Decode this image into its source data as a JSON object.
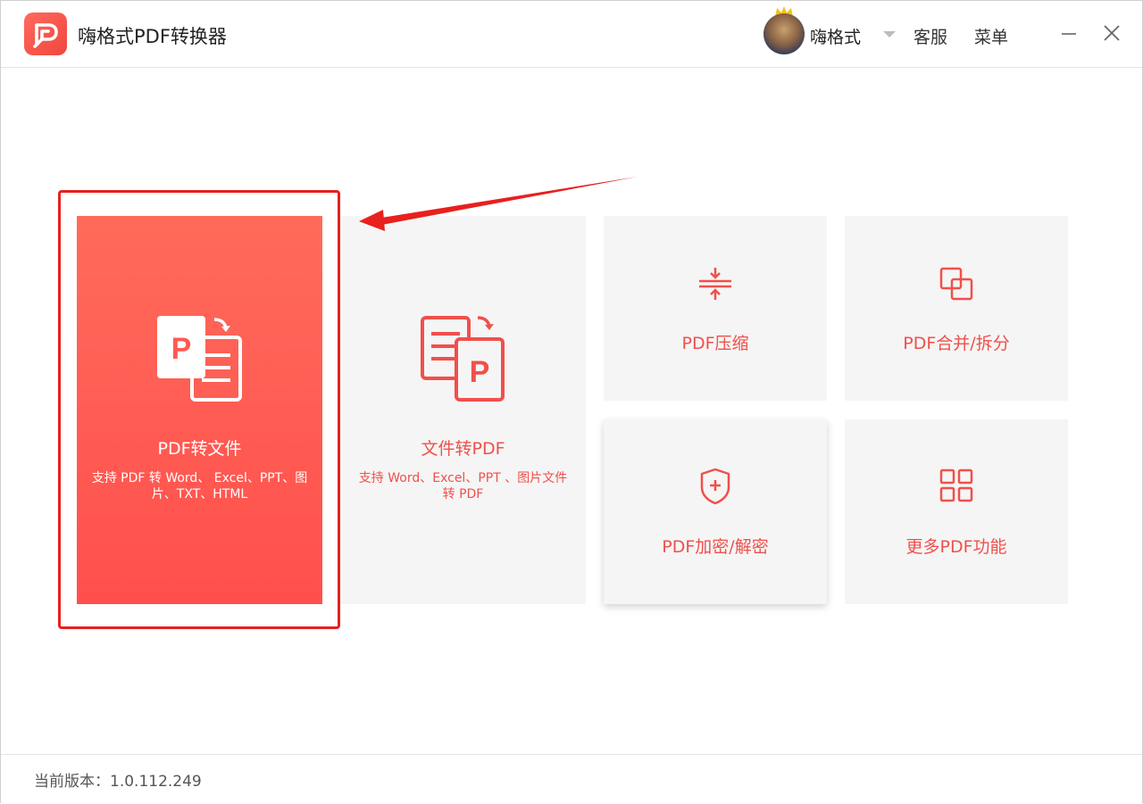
{
  "app": {
    "title": "嗨格式PDF转换器",
    "brand_color": "#f1463f"
  },
  "header": {
    "username": "嗨格式",
    "links": {
      "service": "客服",
      "menu": "菜单"
    },
    "controls": {
      "minimize": "minimize-icon",
      "close": "close-icon"
    }
  },
  "cards": [
    {
      "title": "PDF转文件",
      "desc": "支持 PDF 转 Word、 Excel、PPT、图片、TXT、HTML",
      "icon": "pdf-to-file-icon"
    },
    {
      "title": "文件转PDF",
      "desc": "支持 Word、Excel、PPT 、图片文件转 PDF",
      "icon": "file-to-pdf-icon"
    },
    {
      "title": "PDF压缩",
      "icon": "compress-icon"
    },
    {
      "title": "PDF合并/拆分",
      "icon": "merge-split-icon"
    },
    {
      "title": "PDF加密/解密",
      "icon": "shield-icon"
    },
    {
      "title": "更多PDF功能",
      "icon": "grid-icon"
    }
  ],
  "footer": {
    "version": "当前版本：1.0.112.249"
  },
  "annotation": {
    "color": "#e8201e"
  }
}
